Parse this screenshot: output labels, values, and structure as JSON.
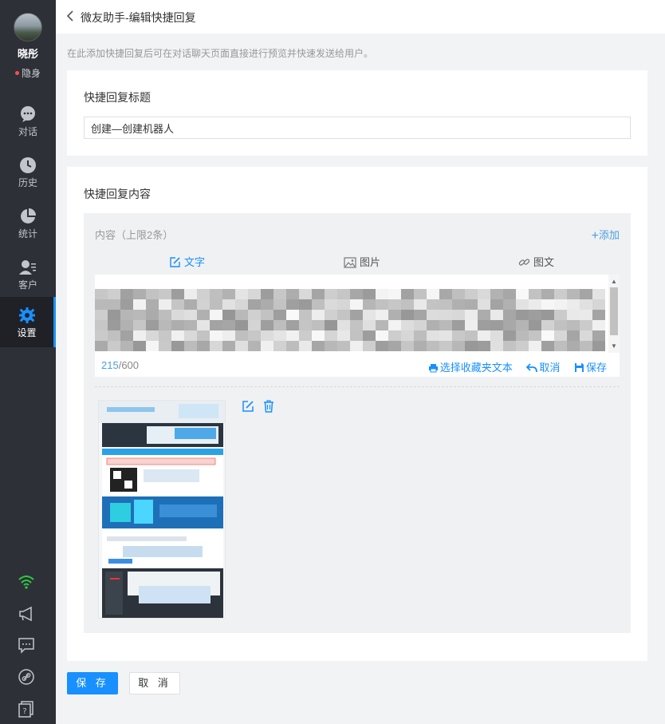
{
  "user": {
    "name": "晓彤",
    "status": "隐身"
  },
  "nav": [
    {
      "label": "对话",
      "icon": "chat-icon"
    },
    {
      "label": "历史",
      "icon": "clock-icon"
    },
    {
      "label": "统计",
      "icon": "pie-chart-icon"
    },
    {
      "label": "客户",
      "icon": "customer-icon"
    },
    {
      "label": "设置",
      "icon": "gear-icon",
      "active": true
    }
  ],
  "header": {
    "title": "微友助手-编辑快捷回复"
  },
  "hint": "在此添加快捷回复后可在对话聊天页面直接进行预览并快速发送给用户。",
  "title_section": {
    "heading": "快捷回复标题",
    "value": "创建—创建机器人"
  },
  "content_section": {
    "heading": "快捷回复内容",
    "label": "内容（上限2条）",
    "add_label": "添加",
    "tabs": [
      {
        "label": "文字",
        "icon": "edit-icon",
        "active": true
      },
      {
        "label": "图片",
        "icon": "image-icon"
      },
      {
        "label": "图文",
        "icon": "link-icon"
      }
    ],
    "counter_current": "215",
    "counter_max": "/600",
    "actions": {
      "favorites": "选择收藏夹文本",
      "cancel": "取消",
      "save": "保存"
    }
  },
  "buttons": {
    "save": "保 存",
    "cancel": "取 消"
  },
  "colors": {
    "accent": "#1890ff",
    "sidebar": "#2e3038",
    "status_dot": "#ff4d4f",
    "wifi": "#2ecc40"
  }
}
